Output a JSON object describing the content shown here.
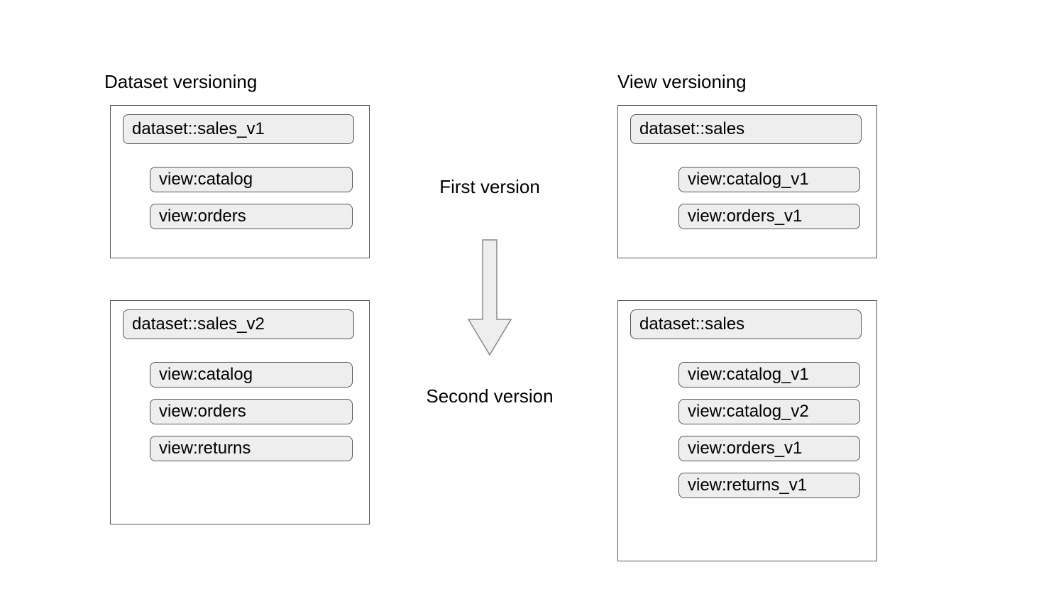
{
  "titles": {
    "left": "Dataset versioning",
    "right": "View versioning"
  },
  "center": {
    "first": "First version",
    "second": "Second version"
  },
  "left": {
    "box1": {
      "dataset": "dataset::sales_v1",
      "views": [
        "view:catalog",
        "view:orders"
      ]
    },
    "box2": {
      "dataset": "dataset::sales_v2",
      "views": [
        "view:catalog",
        "view:orders",
        "view:returns"
      ]
    }
  },
  "right": {
    "box1": {
      "dataset": "dataset::sales",
      "views": [
        "view:catalog_v1",
        "view:orders_v1"
      ]
    },
    "box2": {
      "dataset": "dataset::sales",
      "views": [
        "view:catalog_v1",
        "view:catalog_v2",
        "view:orders_v1",
        "view:returns_v1"
      ]
    }
  }
}
